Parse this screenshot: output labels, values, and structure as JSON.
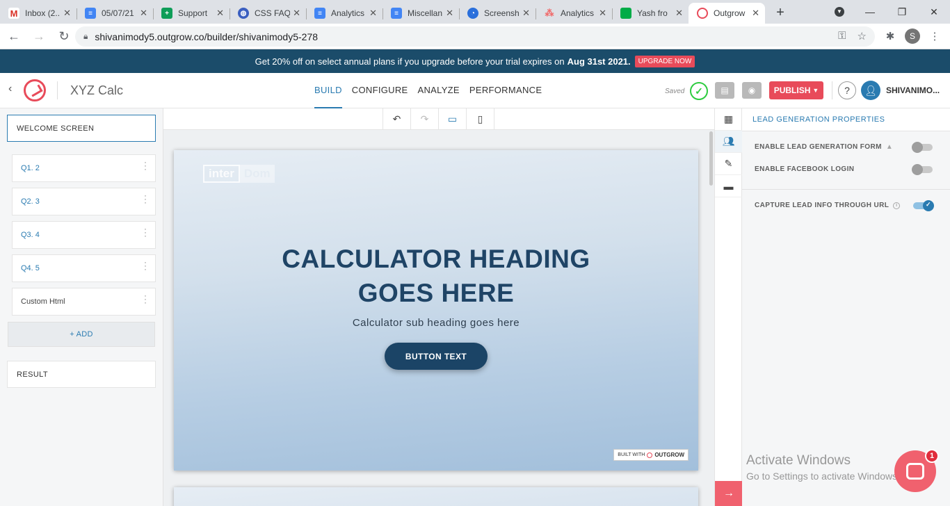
{
  "browser": {
    "tabs": [
      {
        "title": "Inbox (2...",
        "icon": "gmail-icon",
        "color": "#d93025",
        "glyph": "M"
      },
      {
        "title": "05/07/21",
        "icon": "docs-icon",
        "color": "#4285f4",
        "glyph": "≡"
      },
      {
        "title": "Support",
        "icon": "sheets-icon",
        "color": "#0f9d58",
        "glyph": "+"
      },
      {
        "title": "CSS FAQ",
        "icon": "globe-icon",
        "color": "#3b5fc0",
        "glyph": "◍"
      },
      {
        "title": "Analytics",
        "icon": "docs-icon",
        "color": "#4285f4",
        "glyph": "≡"
      },
      {
        "title": "Miscellan",
        "icon": "docs-icon",
        "color": "#4285f4",
        "glyph": "≡"
      },
      {
        "title": "Screensh",
        "icon": "screenshot-icon",
        "color": "#2a6fdb",
        "glyph": "◔"
      },
      {
        "title": "Analytics",
        "icon": "asana-icon",
        "color": "#f06a6a",
        "glyph": "⁂"
      },
      {
        "title": "Yash fro",
        "icon": "chat-icon",
        "color": "#00ac47",
        "glyph": "▪"
      },
      {
        "title": "Outgrow",
        "icon": "outgrow-icon",
        "color": "#e84b5a",
        "glyph": "◎",
        "active": true
      }
    ],
    "url": "shivanimody5.outgrow.co/builder/shivanimody5-278",
    "profile_initial": "S"
  },
  "promo": {
    "text": "Get 20% off on select annual plans if you upgrade before your trial expires on",
    "date": "Aug 31st 2021.",
    "cta": "UPGRADE NOW"
  },
  "header": {
    "calc_name": "XYZ Calc",
    "tabs": [
      "BUILD",
      "CONFIGURE",
      "ANALYZE",
      "PERFORMANCE"
    ],
    "active_tab": "BUILD",
    "saved": "Saved",
    "publish": "PUBLISH",
    "help": "?",
    "username": "SHIVANIMO..."
  },
  "sidebar": {
    "welcome": "WELCOME SCREEN",
    "questions": [
      {
        "label": "Q1. 2"
      },
      {
        "label": "Q2. 3"
      },
      {
        "label": "Q3. 4"
      },
      {
        "label": "Q4. 5"
      },
      {
        "label": "Custom Html"
      }
    ],
    "add": "+ ADD",
    "result": "RESULT"
  },
  "canvas": {
    "brand_left": "inter",
    "brand_right": "Dom",
    "heading_line1": "CALCULATOR HEADING",
    "heading_line2": "GOES HERE",
    "subheading": "Calculator sub heading goes here",
    "button": "BUTTON TEXT",
    "built_with": "BUILT WITH",
    "built_brand": "OUTGROW"
  },
  "properties": {
    "title": "LEAD GENERATION PROPERTIES",
    "rows": [
      {
        "label": "ENABLE LEAD GENERATION FORM",
        "on": false
      },
      {
        "label": "ENABLE FACEBOOK LOGIN",
        "on": false
      },
      {
        "label": "CAPTURE LEAD INFO THROUGH URL",
        "on": true
      }
    ]
  },
  "os": {
    "watermark_title": "Activate Windows",
    "watermark_sub": "Go to Settings to activate Windows."
  },
  "chat": {
    "badge": "1"
  },
  "colors": {
    "brand_red": "#e84b5a",
    "accent_blue": "#2a7bb1",
    "banner": "#1b4c6a",
    "heading": "#1f4466"
  }
}
